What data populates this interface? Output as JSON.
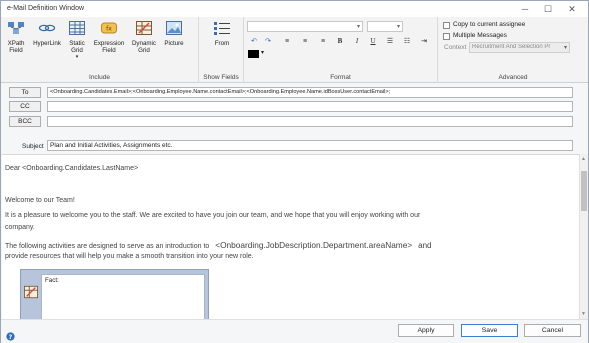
{
  "window": {
    "title": "e-Mail Definition Window"
  },
  "ribbon": {
    "include": {
      "label": "Include",
      "buttons": [
        {
          "line1": "XPath",
          "line2": "Field"
        },
        {
          "line1": "HyperLink",
          "line2": ""
        },
        {
          "line1": "Static",
          "line2": "Grid",
          "line3": "▾"
        },
        {
          "line1": "Expression",
          "line2": "Field"
        },
        {
          "line1": "Dynamic",
          "line2": "Grid"
        },
        {
          "line1": "Picture",
          "line2": ""
        }
      ]
    },
    "show_fields": {
      "label": "Show Fields",
      "from_label": "From"
    },
    "format": {
      "label": "Format",
      "bold": "B",
      "italic": "I",
      "underline": "U"
    },
    "advanced": {
      "label": "Advanced",
      "copy_to_assignee": "Copy to current assignee",
      "multiple_messages": "Multiple Messages",
      "context_label": "Context",
      "context_value": "Recruitment And Selection Pr"
    }
  },
  "header": {
    "to_label": "To",
    "to_value": "<Onboarding.Candidates.Email>;<Onboarding.Employee.Name.contactEmail>;<Onboarding.Employee.Name.idBossUser.contactEmail>;",
    "cc_label": "CC",
    "cc_value": "",
    "bcc_label": "BCC",
    "bcc_value": "",
    "subject_label": "Subject",
    "subject_value": "Plan and Initial Activities, Assignments etc."
  },
  "body": {
    "greeting": "Dear <Onboarding.Candidates.LastName>",
    "welcome": "Welcome to our Team!",
    "para1_line1": "It is a pleasure to welcome you to the staff. We are excited to have you join our team, and we hope that you will enjoy working with our",
    "para1_line2": "company.",
    "para2_before": "The following activities are designed to serve as an introduction to",
    "para2_field": "<Onboarding.JobDescription.Department.areaName>",
    "para2_after": "and",
    "para2_line2": "provide resources that will help you make a smooth transition into your new role.",
    "grid_fact": "Fact:"
  },
  "footer": {
    "apply": "Apply",
    "save": "Save",
    "cancel": "Cancel",
    "help_icon": "help-icon"
  }
}
